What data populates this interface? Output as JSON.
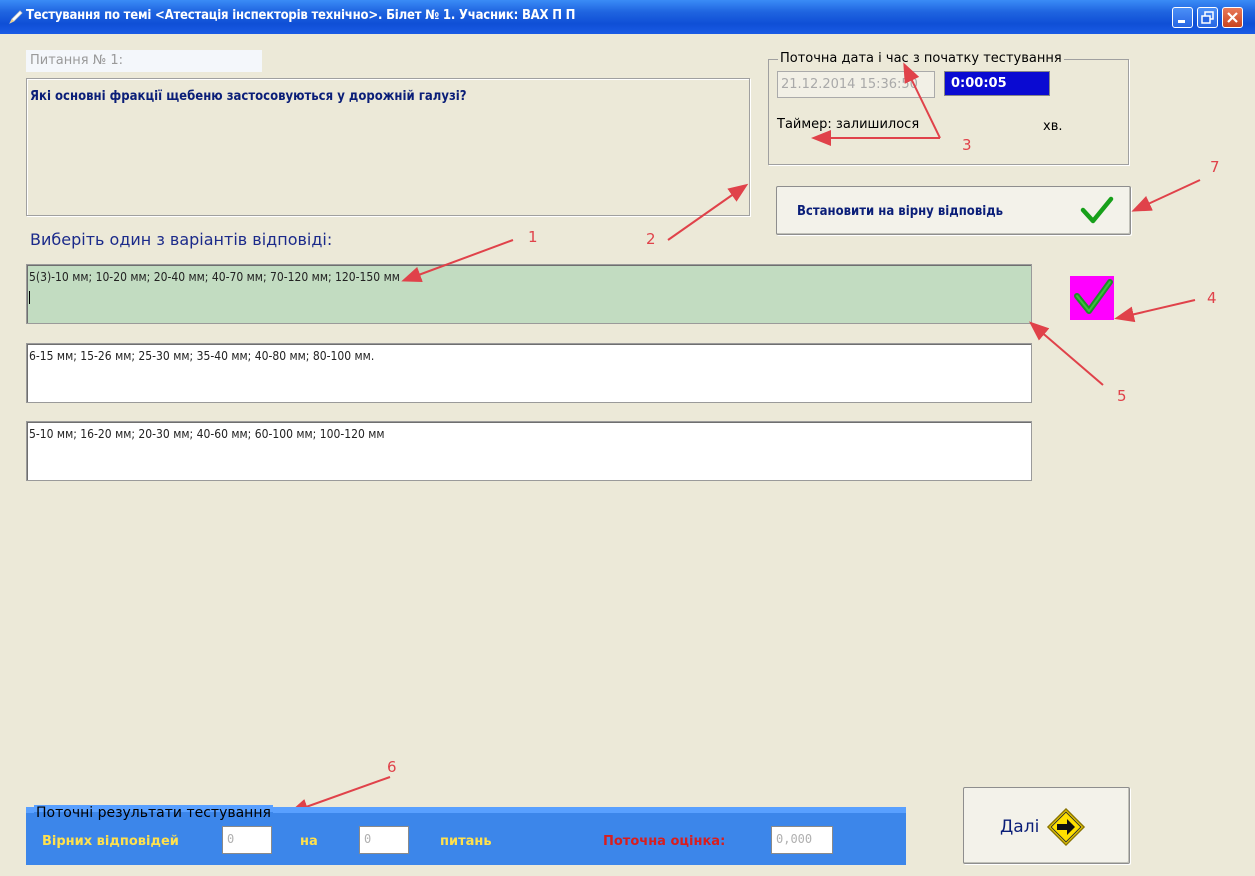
{
  "window": {
    "title": "Тестування по темі <Атестація інспекторів технічно>. Білет № 1. Учасник: ВАХ П П",
    "title_bar_color": "#1f64e0"
  },
  "question": {
    "number_label": "Питання № 1:",
    "text": "Які основні фракції щебеню застосовуються у дорожній галузі?"
  },
  "datetime": {
    "legend": "Поточна дата і час з початку тестування",
    "start_datetime": "21.12.2014 15:36:50",
    "elapsed": "0:00:05",
    "timer_label": "Таймер: залишилося",
    "timer_unit": "хв."
  },
  "set_correct_button": {
    "label": "Встановити на вірну відповідь",
    "icon": "checkmark-icon"
  },
  "choose_label": "Виберіть один з варіантів відповіді:",
  "answers": [
    {
      "text": "5(3)-10 мм; 10-20 мм; 20-40 мм; 40-70 мм; 70-120 мм; 120-150 мм",
      "selected": true,
      "highlight_color": "#c2dcc1"
    },
    {
      "text": "6-15 мм; 15-26 мм; 25-30 мм; 35-40 мм; 40-80 мм; 80-100 мм.",
      "selected": false
    },
    {
      "text": "5-10 мм; 16-20 мм; 20-30 мм; 40-60 мм; 60-100 мм; 100-120 мм",
      "selected": false
    }
  ],
  "correct_indicator": {
    "icon": "checkmark-icon",
    "background": "#ff00ff"
  },
  "annotations": [
    "1",
    "2",
    "3",
    "4",
    "5",
    "6",
    "7"
  ],
  "results": {
    "legend": "Поточні результати тестування",
    "correct_label": "Вірних відповідей",
    "correct_value": "0",
    "of_label": "на",
    "total_value": "0",
    "questions_label": "питань",
    "score_label": "Поточна оцінка:",
    "score_value": "0,000"
  },
  "next_button": {
    "label": "Далі",
    "icon": "arrow-right-sign-icon"
  }
}
